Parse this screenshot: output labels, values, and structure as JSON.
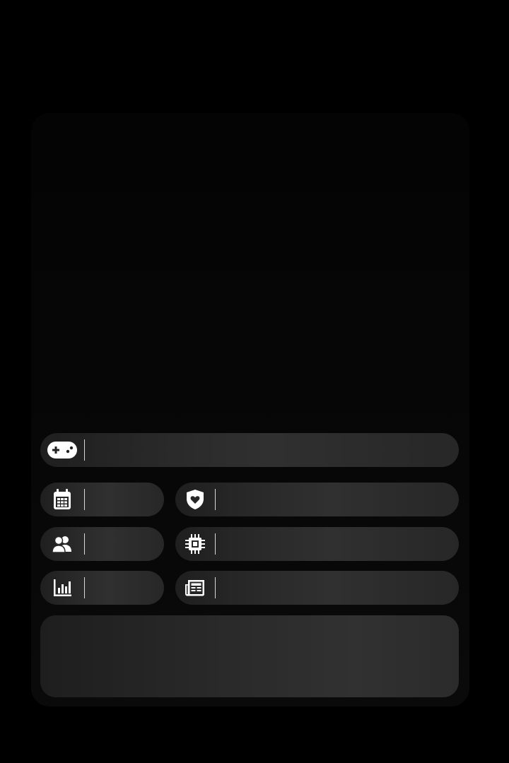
{
  "icons": {
    "game": "gamepad-icon",
    "calendar": "calendar-icon",
    "shield": "shield-heart-icon",
    "users": "users-icon",
    "chip": "cpu-chip-icon",
    "chart": "bar-chart-icon",
    "news": "newspaper-icon"
  },
  "fields": {
    "game": "",
    "calendar": "",
    "shield": "",
    "users": "",
    "chip": "",
    "chart": "",
    "news": ""
  },
  "notes": ""
}
